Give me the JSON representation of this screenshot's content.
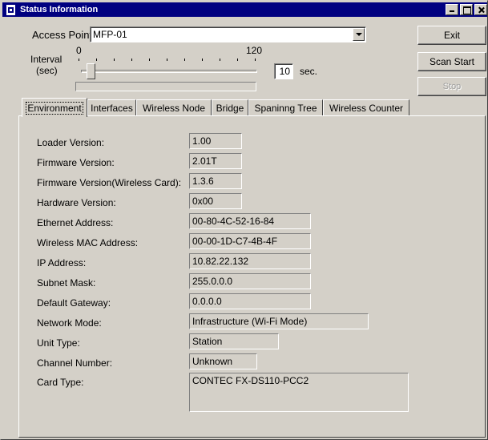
{
  "window": {
    "title": "Status Information"
  },
  "access_point": {
    "label": "Access Point:",
    "value": "MFP-01"
  },
  "interval": {
    "label_line1": "Interval",
    "label_line2": "(sec)",
    "min_label": "0",
    "max_label": "120",
    "value": "10",
    "unit": "sec."
  },
  "buttons": {
    "exit": "Exit",
    "scan_start": "Scan Start",
    "stop": "Stop"
  },
  "tabs": [
    {
      "label": "Environment"
    },
    {
      "label": "Interfaces"
    },
    {
      "label": "Wireless Node"
    },
    {
      "label": "Bridge"
    },
    {
      "label": "Spaninng Tree"
    },
    {
      "label": "Wireless Counter"
    }
  ],
  "fields": [
    {
      "label": "Loader Version:",
      "value": "1.00"
    },
    {
      "label": "Firmware Version:",
      "value": "2.01T"
    },
    {
      "label": "Firmware Version(Wireless Card):",
      "value": "1.3.6"
    },
    {
      "label": "Hardware Version:",
      "value": "0x00"
    },
    {
      "label": "Ethernet Address:",
      "value": "00-80-4C-52-16-84"
    },
    {
      "label": "Wireless MAC Address:",
      "value": "00-00-1D-C7-4B-4F"
    },
    {
      "label": "IP Address:",
      "value": "10.82.22.132"
    },
    {
      "label": "Subnet Mask:",
      "value": "255.0.0.0"
    },
    {
      "label": "Default Gateway:",
      "value": "0.0.0.0"
    },
    {
      "label": "Network Mode:",
      "value": "Infrastructure (Wi-Fi Mode)"
    },
    {
      "label": "Unit Type:",
      "value": "Station"
    },
    {
      "label": "Channel Number:",
      "value": "Unknown"
    },
    {
      "label": "Card Type:",
      "value": "CONTEC FX-DS110-PCC2"
    }
  ]
}
